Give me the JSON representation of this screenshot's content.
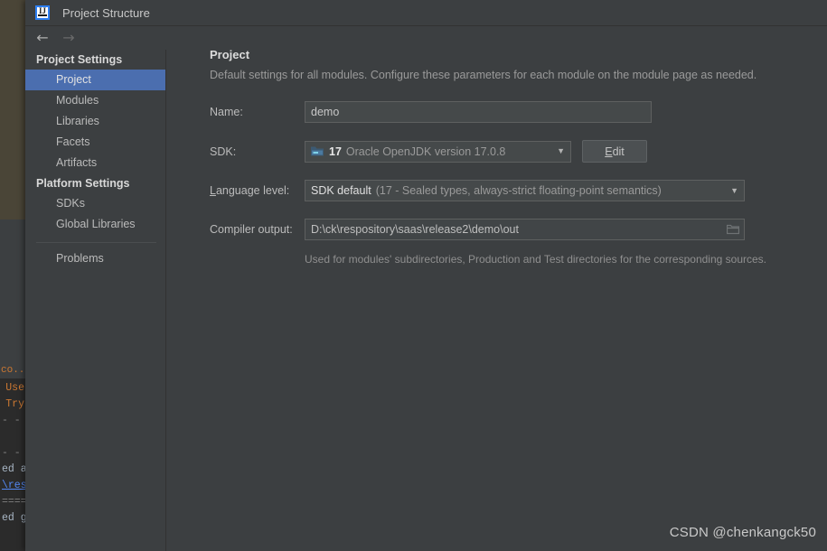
{
  "window": {
    "title": "Project Structure",
    "logo_icon": "intellij-idea-logo-icon"
  },
  "navbar": {
    "back_icon": "arrow-left-icon",
    "forward_icon": "arrow-right-icon"
  },
  "sidebar": {
    "groups": [
      {
        "label": "Project Settings",
        "items": [
          {
            "label": "Project",
            "selected": true
          },
          {
            "label": "Modules",
            "selected": false
          },
          {
            "label": "Libraries",
            "selected": false
          },
          {
            "label": "Facets",
            "selected": false
          },
          {
            "label": "Artifacts",
            "selected": false
          }
        ]
      },
      {
        "label": "Platform Settings",
        "items": [
          {
            "label": "SDKs",
            "selected": false
          },
          {
            "label": "Global Libraries",
            "selected": false
          }
        ]
      }
    ],
    "footer_items": [
      {
        "label": "Problems",
        "selected": false
      }
    ]
  },
  "content": {
    "title": "Project",
    "subtitle": "Default settings for all modules. Configure these parameters for each module on the module page as needed.",
    "name_field": {
      "label": "Name:",
      "value": "demo"
    },
    "sdk_field": {
      "label": "SDK:",
      "icon": "jdk-folder-icon",
      "version": "17",
      "name": "Oracle OpenJDK version 17.0.8",
      "dropdown_icon": "chevron-down-icon",
      "edit_button": {
        "label": "Edit",
        "mnemonic": "E",
        "label_rest": "dit"
      }
    },
    "language_level_field": {
      "label_mnemonic": "L",
      "label_rest": "anguage level:",
      "value_main": "SDK default",
      "value_detail": "(17 - Sealed types, always-strict floating-point semantics)",
      "dropdown_icon": "chevron-down-icon"
    },
    "compiler_output_field": {
      "label": "Compiler output:",
      "value": "D:\\ck\\respository\\saas\\release2\\demo\\out",
      "browse_icon": "folder-browse-icon",
      "hint": "Used for modules' subdirectories, Production and Test directories for the corresponding sources."
    }
  },
  "background": {
    "console_tab": "co...",
    "console_lines": [
      {
        "text": "Use",
        "kind": "warn"
      },
      {
        "text": "Try",
        "kind": "warn"
      },
      {
        "text": "- - -",
        "kind": "dash"
      },
      {
        "text": "",
        "kind": "plain"
      },
      {
        "text": "- - -",
        "kind": "dash"
      },
      {
        "text": "ed a",
        "kind": "plain"
      },
      {
        "text": "\\res",
        "kind": "link"
      },
      {
        "text": "====",
        "kind": "dash"
      },
      {
        "text": "ed g",
        "kind": "plain"
      }
    ]
  },
  "watermark": "CSDN @chenkangck50",
  "colors": {
    "panel_bg": "#3c3f41",
    "selection_blue": "#4b6eaf",
    "field_bg": "#45494a",
    "editor_olive": "#4a4537",
    "console_bg": "#2b2b2b",
    "accent_link": "#548af7"
  }
}
